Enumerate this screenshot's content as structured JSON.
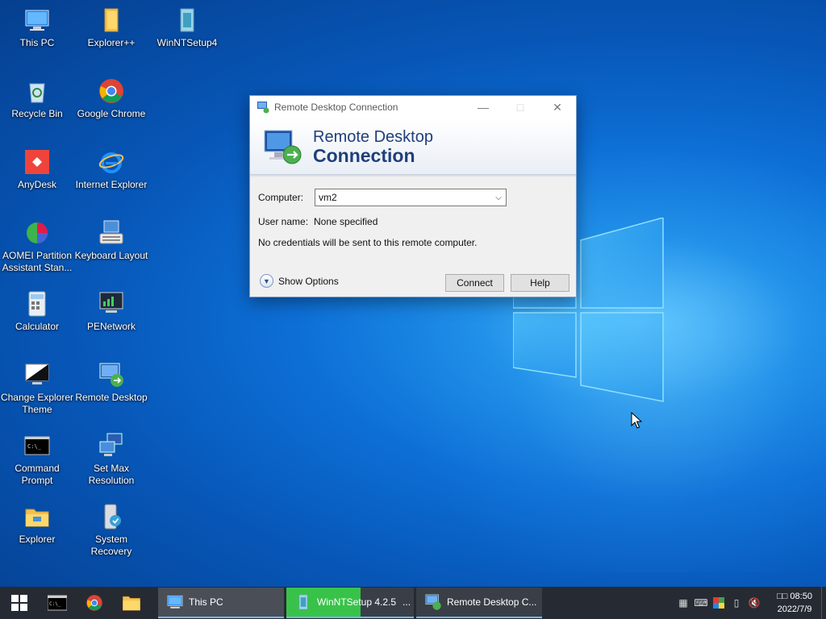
{
  "desktop": {
    "icons": [
      {
        "label": "This PC",
        "icon": "this-pc-icon"
      },
      {
        "label": "Explorer++",
        "icon": "folder-icon"
      },
      {
        "label": "WinNTSetup4",
        "icon": "winntsetup-icon"
      },
      {
        "label": "Recycle Bin",
        "icon": "recycle-bin-icon"
      },
      {
        "label": "Google Chrome",
        "icon": "chrome-icon"
      },
      {
        "label": "AnyDesk",
        "icon": "anydesk-icon"
      },
      {
        "label": "Internet Explorer",
        "icon": "internet-explorer-icon"
      },
      {
        "label": "AOMEI Partition Assistant Stan...",
        "icon": "aomei-icon"
      },
      {
        "label": "Keyboard Layout",
        "icon": "keyboard-icon"
      },
      {
        "label": "Calculator",
        "icon": "calculator-icon"
      },
      {
        "label": "PENetwork",
        "icon": "network-icon"
      },
      {
        "label": "Change Explorer Theme",
        "icon": "theme-icon"
      },
      {
        "label": "Remote Desktop",
        "icon": "remote-desktop-icon"
      },
      {
        "label": "Command Prompt",
        "icon": "command-prompt-icon"
      },
      {
        "label": "Set Max Resolution",
        "icon": "display-icon"
      },
      {
        "label": "Explorer",
        "icon": "folder-icon"
      },
      {
        "label": "System Recovery",
        "icon": "system-recovery-icon"
      }
    ]
  },
  "dialog": {
    "title": "Remote Desktop Connection",
    "banner_line1": "Remote Desktop",
    "banner_line2": "Connection",
    "computer_label": "Computer:",
    "computer_value": "vm2",
    "username_label": "User name:",
    "username_value": "None specified",
    "credentials_note": "No credentials will be sent to this remote computer.",
    "show_options_label": "Show Options",
    "connect_label": "Connect",
    "help_label": "Help"
  },
  "taskbar": {
    "tasks": [
      {
        "label": "This PC"
      },
      {
        "label": "WinNTSetup 4.2.5",
        "suffix": "..."
      },
      {
        "label": "Remote Desktop C..."
      }
    ],
    "winnt_progress": 0.58,
    "clock_time": "□□ 08:50",
    "clock_date": "2022/7/9"
  },
  "colors": {
    "accent": "#0078d7",
    "taskbar": "#262b33",
    "banner_text": "#1f3f7a",
    "progress_green": "#39c24a"
  }
}
